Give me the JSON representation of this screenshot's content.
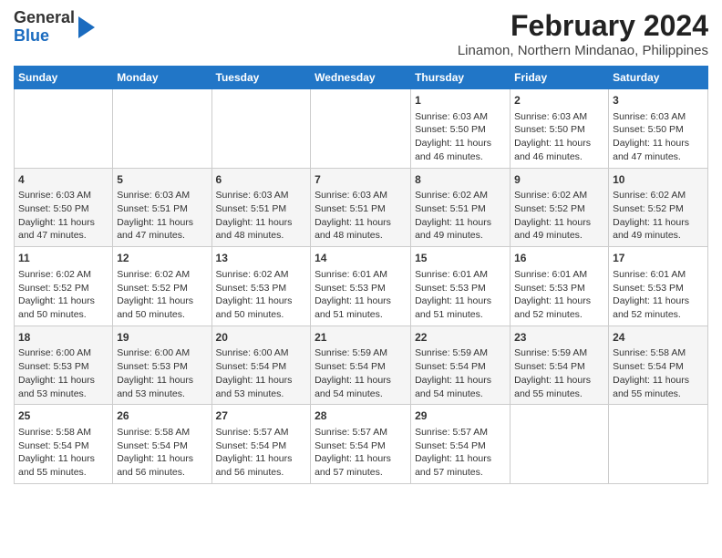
{
  "header": {
    "logo_line1": "General",
    "logo_line2": "Blue",
    "title": "February 2024",
    "subtitle": "Linamon, Northern Mindanao, Philippines"
  },
  "weekdays": [
    "Sunday",
    "Monday",
    "Tuesday",
    "Wednesday",
    "Thursday",
    "Friday",
    "Saturday"
  ],
  "weeks": [
    [
      {
        "day": "",
        "info": ""
      },
      {
        "day": "",
        "info": ""
      },
      {
        "day": "",
        "info": ""
      },
      {
        "day": "",
        "info": ""
      },
      {
        "day": "1",
        "info": "Sunrise: 6:03 AM\nSunset: 5:50 PM\nDaylight: 11 hours and 46 minutes."
      },
      {
        "day": "2",
        "info": "Sunrise: 6:03 AM\nSunset: 5:50 PM\nDaylight: 11 hours and 46 minutes."
      },
      {
        "day": "3",
        "info": "Sunrise: 6:03 AM\nSunset: 5:50 PM\nDaylight: 11 hours and 47 minutes."
      }
    ],
    [
      {
        "day": "4",
        "info": "Sunrise: 6:03 AM\nSunset: 5:50 PM\nDaylight: 11 hours and 47 minutes."
      },
      {
        "day": "5",
        "info": "Sunrise: 6:03 AM\nSunset: 5:51 PM\nDaylight: 11 hours and 47 minutes."
      },
      {
        "day": "6",
        "info": "Sunrise: 6:03 AM\nSunset: 5:51 PM\nDaylight: 11 hours and 48 minutes."
      },
      {
        "day": "7",
        "info": "Sunrise: 6:03 AM\nSunset: 5:51 PM\nDaylight: 11 hours and 48 minutes."
      },
      {
        "day": "8",
        "info": "Sunrise: 6:02 AM\nSunset: 5:51 PM\nDaylight: 11 hours and 49 minutes."
      },
      {
        "day": "9",
        "info": "Sunrise: 6:02 AM\nSunset: 5:52 PM\nDaylight: 11 hours and 49 minutes."
      },
      {
        "day": "10",
        "info": "Sunrise: 6:02 AM\nSunset: 5:52 PM\nDaylight: 11 hours and 49 minutes."
      }
    ],
    [
      {
        "day": "11",
        "info": "Sunrise: 6:02 AM\nSunset: 5:52 PM\nDaylight: 11 hours and 50 minutes."
      },
      {
        "day": "12",
        "info": "Sunrise: 6:02 AM\nSunset: 5:52 PM\nDaylight: 11 hours and 50 minutes."
      },
      {
        "day": "13",
        "info": "Sunrise: 6:02 AM\nSunset: 5:53 PM\nDaylight: 11 hours and 50 minutes."
      },
      {
        "day": "14",
        "info": "Sunrise: 6:01 AM\nSunset: 5:53 PM\nDaylight: 11 hours and 51 minutes."
      },
      {
        "day": "15",
        "info": "Sunrise: 6:01 AM\nSunset: 5:53 PM\nDaylight: 11 hours and 51 minutes."
      },
      {
        "day": "16",
        "info": "Sunrise: 6:01 AM\nSunset: 5:53 PM\nDaylight: 11 hours and 52 minutes."
      },
      {
        "day": "17",
        "info": "Sunrise: 6:01 AM\nSunset: 5:53 PM\nDaylight: 11 hours and 52 minutes."
      }
    ],
    [
      {
        "day": "18",
        "info": "Sunrise: 6:00 AM\nSunset: 5:53 PM\nDaylight: 11 hours and 53 minutes."
      },
      {
        "day": "19",
        "info": "Sunrise: 6:00 AM\nSunset: 5:53 PM\nDaylight: 11 hours and 53 minutes."
      },
      {
        "day": "20",
        "info": "Sunrise: 6:00 AM\nSunset: 5:54 PM\nDaylight: 11 hours and 53 minutes."
      },
      {
        "day": "21",
        "info": "Sunrise: 5:59 AM\nSunset: 5:54 PM\nDaylight: 11 hours and 54 minutes."
      },
      {
        "day": "22",
        "info": "Sunrise: 5:59 AM\nSunset: 5:54 PM\nDaylight: 11 hours and 54 minutes."
      },
      {
        "day": "23",
        "info": "Sunrise: 5:59 AM\nSunset: 5:54 PM\nDaylight: 11 hours and 55 minutes."
      },
      {
        "day": "24",
        "info": "Sunrise: 5:58 AM\nSunset: 5:54 PM\nDaylight: 11 hours and 55 minutes."
      }
    ],
    [
      {
        "day": "25",
        "info": "Sunrise: 5:58 AM\nSunset: 5:54 PM\nDaylight: 11 hours and 55 minutes."
      },
      {
        "day": "26",
        "info": "Sunrise: 5:58 AM\nSunset: 5:54 PM\nDaylight: 11 hours and 56 minutes."
      },
      {
        "day": "27",
        "info": "Sunrise: 5:57 AM\nSunset: 5:54 PM\nDaylight: 11 hours and 56 minutes."
      },
      {
        "day": "28",
        "info": "Sunrise: 5:57 AM\nSunset: 5:54 PM\nDaylight: 11 hours and 57 minutes."
      },
      {
        "day": "29",
        "info": "Sunrise: 5:57 AM\nSunset: 5:54 PM\nDaylight: 11 hours and 57 minutes."
      },
      {
        "day": "",
        "info": ""
      },
      {
        "day": "",
        "info": ""
      }
    ]
  ]
}
